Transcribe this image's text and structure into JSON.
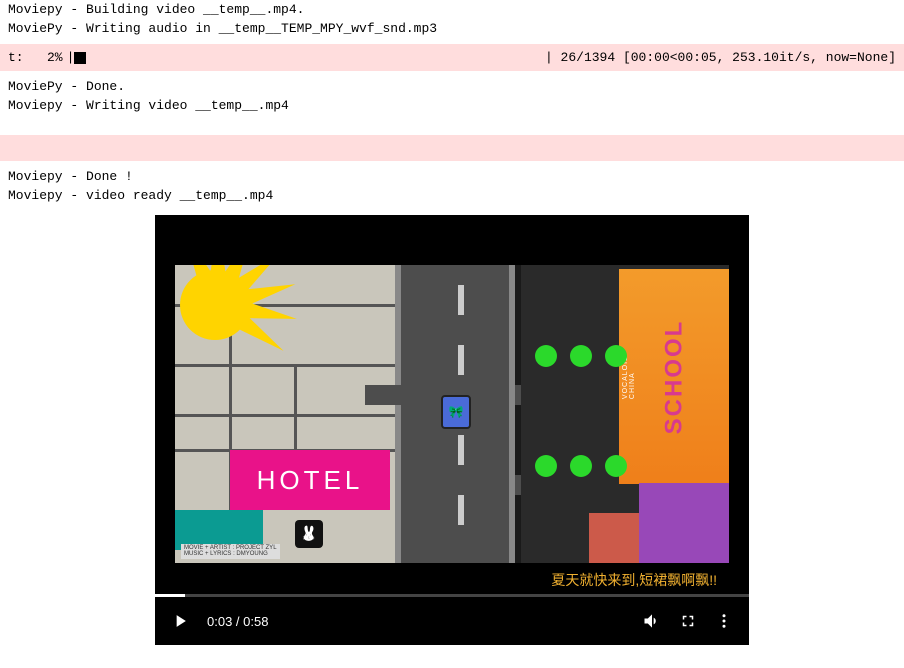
{
  "log": {
    "line1": "Moviepy - Building video __temp__.mp4.",
    "line2": "MoviePy - Writing audio in __temp__TEMP_MPY_wvf_snd.mp3",
    "line3": "MoviePy - Done.",
    "line4": "Moviepy - Writing video __temp__.mp4",
    "line5": "Moviepy - Done !",
    "line6": "Moviepy - video ready __temp__.mp4"
  },
  "progress": {
    "prefix": "t:   2%",
    "pipe_left": "|",
    "right": "| 26/1394 [00:00<00:05, 253.10it/s, now=None]"
  },
  "video": {
    "scene": {
      "hotel_label": "HOTEL",
      "school_label": "SCHOOL",
      "school_sub": "VOCALOID CHINA",
      "credits_line1": "MOVIE + ARTIST : PROJECT ZYL",
      "credits_line2": "MUSIC + LYRICS : DMYOUNG"
    },
    "subtitle": "夏天就快来到,短裙飘啊飘!!",
    "controls": {
      "current_time": "0:03",
      "duration": "0:58",
      "time_display": "0:03 / 0:58",
      "progress_pct": 5
    }
  }
}
